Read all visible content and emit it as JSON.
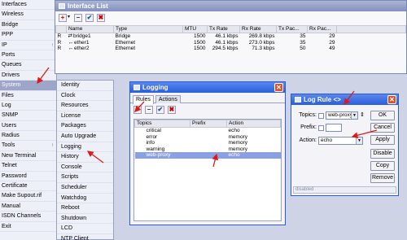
{
  "main_menu": {
    "items": [
      {
        "label": "Interfaces"
      },
      {
        "label": "Wireless"
      },
      {
        "label": "Bridge"
      },
      {
        "label": "PPP"
      },
      {
        "label": "IP",
        "arrow": "↑"
      },
      {
        "label": "Ports"
      },
      {
        "label": "Queues"
      },
      {
        "label": "Drivers"
      },
      {
        "label": "System",
        "selected": true
      },
      {
        "label": "Files"
      },
      {
        "label": "Log"
      },
      {
        "label": "SNMP"
      },
      {
        "label": "Users"
      },
      {
        "label": "Radius"
      },
      {
        "label": "Tools",
        "arrow": "↑"
      },
      {
        "label": "New Terminal"
      },
      {
        "label": "Telnet"
      },
      {
        "label": "Password"
      },
      {
        "label": "Certificate"
      },
      {
        "label": "Make Supout.rif"
      },
      {
        "label": "Manual"
      },
      {
        "label": "ISDN Channels"
      },
      {
        "label": "Exit"
      }
    ]
  },
  "submenu": {
    "items": [
      "Identity",
      "Clock",
      "Resources",
      "License",
      "Packages",
      "Auto Upgrade",
      "Logging",
      "History",
      "Console",
      "Scripts",
      "Scheduler",
      "Watchdog",
      "Reboot",
      "Shutdown",
      "LCD",
      "NTP Client"
    ]
  },
  "interface_list": {
    "title": "Interface List",
    "columns": [
      "",
      "Name",
      "Type",
      "MTU",
      "Tx Rate",
      "Rx Rate",
      "Tx Pac...",
      "Rx Pac..."
    ],
    "rows": [
      {
        "flag": "R",
        "name": "bridge1",
        "type": "Bridge",
        "mtu": "1500",
        "tx_rate": "46.1 kbps",
        "rx_rate": "269.8 kbps",
        "tx_pac": "35",
        "rx_pac": "29"
      },
      {
        "flag": "R",
        "name": "ether1",
        "type": "Ethernet",
        "mtu": "1500",
        "tx_rate": "46.1 kbps",
        "rx_rate": "273.0 kbps",
        "tx_pac": "35",
        "rx_pac": "29"
      },
      {
        "flag": "R",
        "name": "ether2",
        "type": "Ethernet",
        "mtu": "1500",
        "tx_rate": "294.5 kbps",
        "rx_rate": "71.3 kbps",
        "tx_pac": "50",
        "rx_pac": "49"
      }
    ]
  },
  "logging": {
    "title": "Logging",
    "tabs": [
      "Rules",
      "Actions"
    ],
    "columns": [
      "Topics",
      "Prefix",
      "Action"
    ],
    "rows": [
      {
        "topics": "critical",
        "prefix": "",
        "action": "echo"
      },
      {
        "topics": "error",
        "prefix": "",
        "action": "memory"
      },
      {
        "topics": "info",
        "prefix": "",
        "action": "memory"
      },
      {
        "topics": "warning",
        "prefix": "",
        "action": "memory"
      },
      {
        "topics": "web-proxy",
        "prefix": "",
        "action": "echo",
        "selected": true
      }
    ]
  },
  "log_rule": {
    "title": "Log Rule <>",
    "topics_label": "Topics:",
    "topics_value": "web-proxy",
    "prefix_label": "Prefix:",
    "prefix_value": "",
    "action_label": "Action:",
    "action_value": "echo",
    "buttons": [
      "OK",
      "Cancel",
      "Apply",
      "Disable",
      "Copy",
      "Remove"
    ],
    "status": "disabled"
  },
  "colors": {
    "accent": "#2b5fd9",
    "annotation": "#e01818",
    "selection": "#8aa0e6"
  }
}
